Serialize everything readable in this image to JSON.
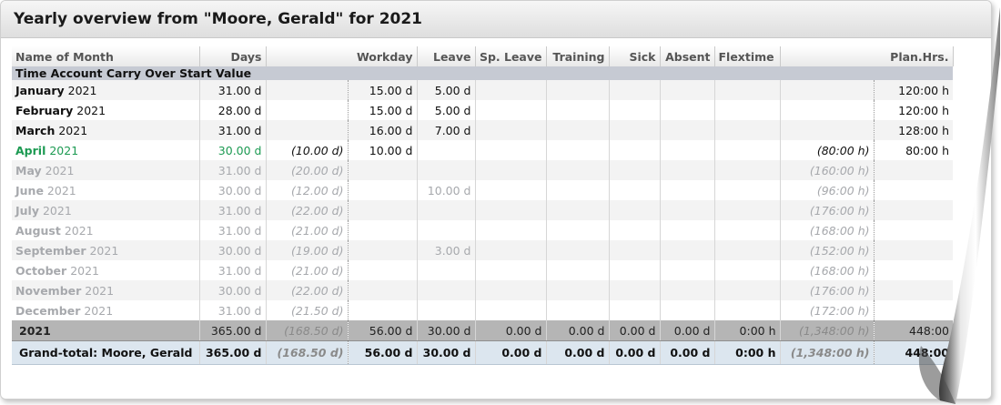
{
  "title": "Yearly overview from \"Moore, Gerald\" for 2021",
  "columns": [
    "Name of Month",
    "Days",
    "Workday",
    "Leave",
    "Sp. Leave",
    "Training",
    "Sick",
    "Absent",
    "Flextime",
    "Plan.Hrs."
  ],
  "carry_over_label": "Time Account Carry Over Start Value",
  "months": [
    {
      "month": "January",
      "year": "2021",
      "days": "31.00 d",
      "plan_days": "",
      "workday": "15.00 d",
      "leave": "5.00 d",
      "plan_hrs": "",
      "hrs": "120:00 h",
      "state": "done"
    },
    {
      "month": "February",
      "year": "2021",
      "days": "28.00 d",
      "plan_days": "",
      "workday": "15.00 d",
      "leave": "5.00 d",
      "plan_hrs": "",
      "hrs": "120:00 h",
      "state": "done"
    },
    {
      "month": "March",
      "year": "2021",
      "days": "31.00 d",
      "plan_days": "",
      "workday": "16.00 d",
      "leave": "7.00 d",
      "plan_hrs": "",
      "hrs": "128:00 h",
      "state": "done"
    },
    {
      "month": "April",
      "year": "2021",
      "days": "30.00 d",
      "plan_days": "(10.00 d)",
      "workday": "10.00 d",
      "leave": "",
      "plan_hrs": "(80:00 h)",
      "hrs": "80:00 h",
      "state": "cur"
    },
    {
      "month": "May",
      "year": "2021",
      "days": "31.00 d",
      "plan_days": "(20.00 d)",
      "workday": "",
      "leave": "",
      "plan_hrs": "(160:00 h)",
      "hrs": "",
      "state": "future"
    },
    {
      "month": "June",
      "year": "2021",
      "days": "30.00 d",
      "plan_days": "(12.00 d)",
      "workday": "",
      "leave": "10.00 d",
      "plan_hrs": "(96:00 h)",
      "hrs": "",
      "state": "future"
    },
    {
      "month": "July",
      "year": "2021",
      "days": "31.00 d",
      "plan_days": "(22.00 d)",
      "workday": "",
      "leave": "",
      "plan_hrs": "(176:00 h)",
      "hrs": "",
      "state": "future"
    },
    {
      "month": "August",
      "year": "2021",
      "days": "31.00 d",
      "plan_days": "(21.00 d)",
      "workday": "",
      "leave": "",
      "plan_hrs": "(168:00 h)",
      "hrs": "",
      "state": "future"
    },
    {
      "month": "September",
      "year": "2021",
      "days": "30.00 d",
      "plan_days": "(19.00 d)",
      "workday": "",
      "leave": "3.00 d",
      "plan_hrs": "(152:00 h)",
      "hrs": "",
      "state": "future"
    },
    {
      "month": "October",
      "year": "2021",
      "days": "31.00 d",
      "plan_days": "(21.00 d)",
      "workday": "",
      "leave": "",
      "plan_hrs": "(168:00 h)",
      "hrs": "",
      "state": "future"
    },
    {
      "month": "November",
      "year": "2021",
      "days": "30.00 d",
      "plan_days": "(22.00 d)",
      "workday": "",
      "leave": "",
      "plan_hrs": "(176:00 h)",
      "hrs": "",
      "state": "future"
    },
    {
      "month": "December",
      "year": "2021",
      "days": "31.00 d",
      "plan_days": "(21.50 d)",
      "workday": "",
      "leave": "",
      "plan_hrs": "(172:00 h)",
      "hrs": "",
      "state": "future"
    }
  ],
  "year_total": {
    "label": "2021",
    "days": "365.00 d",
    "plan_days": "(168.50 d)",
    "workday": "56.00 d",
    "leave": "30.00 d",
    "sp_leave": "0.00 d",
    "training": "0.00 d",
    "sick": "0.00 d",
    "absent": "0.00 d",
    "flextime": "0:00 h",
    "plan_hrs": "(1,348:00 h)",
    "hrs": "448:00"
  },
  "grand_total": {
    "label": "Grand-total: Moore, Gerald",
    "days": "365.00 d",
    "plan_days": "(168.50 d)",
    "workday": "56.00 d",
    "leave": "30.00 d",
    "sp_leave": "0.00 d",
    "training": "0.00 d",
    "sick": "0.00 d",
    "absent": "0.00 d",
    "flextime": "0:00 h",
    "plan_hrs": "(1,348:00 h)",
    "hrs": "448:00"
  }
}
